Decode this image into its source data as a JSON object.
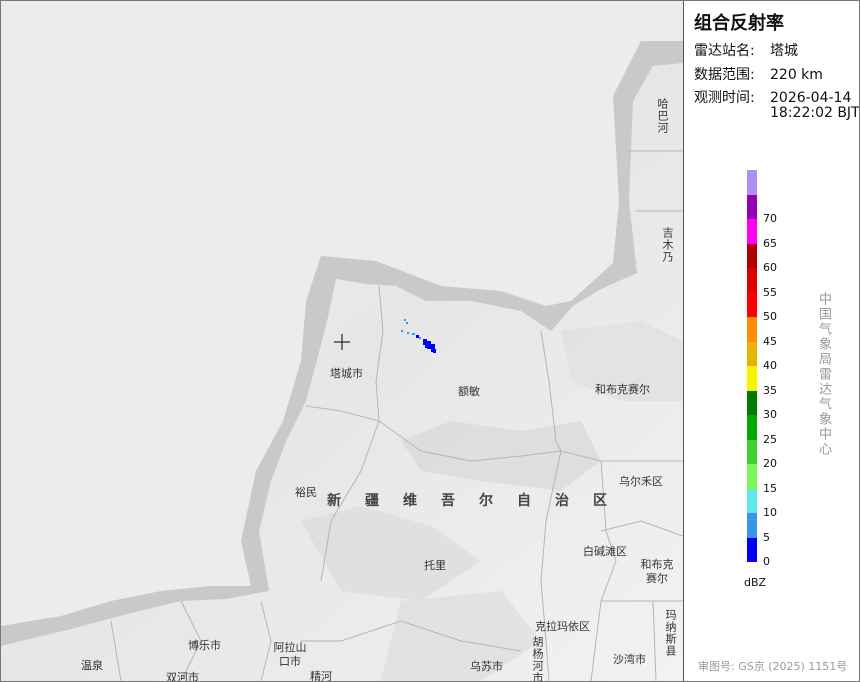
{
  "panel": {
    "title": "组合反射率",
    "station_key": "雷达站名:",
    "station_value": "塔城",
    "range_key": "数据范围:",
    "range_value": "220 km",
    "time_key": "观测时间:",
    "time_date": "2026-04-14",
    "time_clock": "18:22:02 BJT",
    "unit": "dBZ",
    "org": "中国气象局雷达气象中心",
    "approval": "审图号: GS京 (2025) 1151号"
  },
  "legend": [
    {
      "value": "0",
      "color": "#0000f6"
    },
    {
      "value": "5",
      "color": "#3a95e8"
    },
    {
      "value": "10",
      "color": "#5ee8e8"
    },
    {
      "value": "15",
      "color": "#7cf55a"
    },
    {
      "value": "20",
      "color": "#3ed12f"
    },
    {
      "value": "25",
      "color": "#00a800"
    },
    {
      "value": "30",
      "color": "#007a00"
    },
    {
      "value": "35",
      "color": "#f5f500"
    },
    {
      "value": "40",
      "color": "#e6b400"
    },
    {
      "value": "45",
      "color": "#ff8c00"
    },
    {
      "value": "50",
      "color": "#ff0000"
    },
    {
      "value": "55",
      "color": "#e00000"
    },
    {
      "value": "60",
      "color": "#b00000"
    },
    {
      "value": "65",
      "color": "#ff00f0"
    },
    {
      "value": "70",
      "color": "#9600b4"
    },
    {
      "value": "",
      "color": "#ad90f0"
    }
  ],
  "map": {
    "station_marker": "crosshair-icon",
    "labels": {
      "tacheng": "塔城市",
      "emin": "额敏",
      "hobuksar": "和布克赛尔",
      "yumin": "裕民",
      "xinjiang": "新疆维吾尔自治区",
      "urho": "乌尔禾区",
      "baijiantan": "白碱滩区",
      "hebukesaier2": "和布克赛尔",
      "tuoli": "托里",
      "bole": "博乐市",
      "alashankou": "阿拉山口市",
      "wenquan": "温泉",
      "shuanghe": "双河市",
      "jinghe": "精河",
      "wusu": "乌苏市",
      "karamay": "克拉玛依区",
      "huyanghe": "胡杨河市",
      "shawan": "沙湾市",
      "manasi": "玛纳斯县",
      "habahe": "哈巴河",
      "jimunai": "吉木乃"
    }
  }
}
